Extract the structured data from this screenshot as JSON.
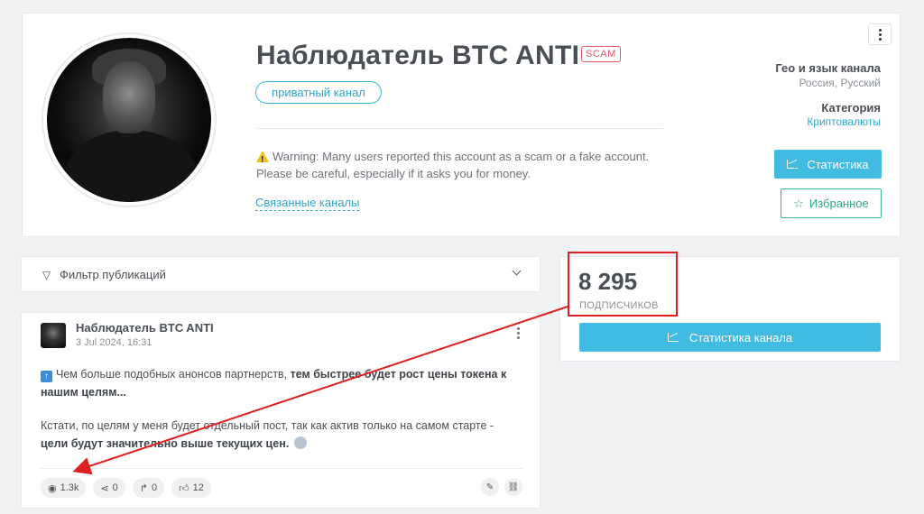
{
  "profile": {
    "title": "Наблюдатель BTC ANTI",
    "scam_badge": "SCAM",
    "private_label": "приватный канал",
    "warning_line1": "Warning: Many users reported this account as a scam or a fake account.",
    "warning_line2": "Please be careful, especially if it asks you for money.",
    "related_link": "Связанные каналы",
    "geo_label": "Гео и язык канала",
    "geo_value": "Россия, Русский",
    "category_label": "Категория",
    "category_value": "Криптовалюты",
    "stats_button": "Статистика",
    "favorite_button": "Избранное"
  },
  "filter": {
    "label": "Фильтр публикаций"
  },
  "post": {
    "author": "Наблюдатель BTC ANTI",
    "date": "3 Jul 2024, 16:31",
    "p1_normal": "Чем больше подобных анонсов партнерств, ",
    "p1_bold": "тем быстрее будет рост цены токена к нашим целям...",
    "p2_normal": "Кстати, по целям у меня будет отдельный пост, так как актив только на самом старте - ",
    "p2_bold": "цели будут значительно выше текущих цен.",
    "views": "1.3k",
    "shares": "0",
    "forwards": "0",
    "likes": "12"
  },
  "subscribers": {
    "count": "8 295",
    "label": "ПОДПИСЧИКОВ",
    "stats_button": "Статистика канала"
  },
  "colors": {
    "accent": "#42bbe2",
    "favorite": "#2ca883",
    "scam": "#e0585e",
    "annotation": "#e02020"
  }
}
